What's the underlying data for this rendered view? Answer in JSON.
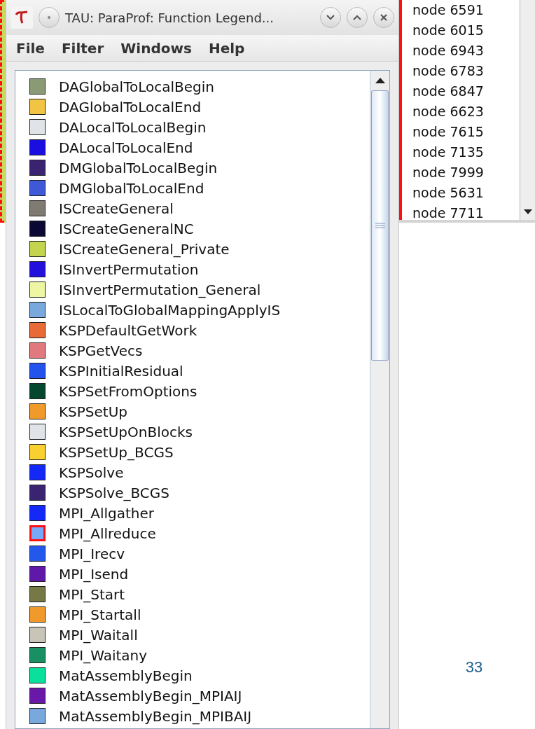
{
  "window": {
    "title": "TAU: ParaProf: Function Legend..."
  },
  "menu": [
    "File",
    "Filter",
    "Windows",
    "Help"
  ],
  "functions": [
    {
      "name": "DAGlobalToLocalBegin",
      "color": "#8a9a74",
      "selected": false
    },
    {
      "name": "DAGlobalToLocalEnd",
      "color": "#f2c444",
      "selected": false
    },
    {
      "name": "DALocalToLocalBegin",
      "color": "#e0e4e8",
      "selected": false
    },
    {
      "name": "DALocalToLocalEnd",
      "color": "#1a0ee0",
      "selected": false
    },
    {
      "name": "DMGlobalToLocalBegin",
      "color": "#3a2370",
      "selected": false
    },
    {
      "name": "DMGlobalToLocalEnd",
      "color": "#3e58d6",
      "selected": false
    },
    {
      "name": "ISCreateGeneral",
      "color": "#7f7a72",
      "selected": false
    },
    {
      "name": "ISCreateGeneralNC",
      "color": "#0c0834",
      "selected": false
    },
    {
      "name": "ISCreateGeneral_Private",
      "color": "#c4d44e",
      "selected": false
    },
    {
      "name": "ISInvertPermutation",
      "color": "#2410dc",
      "selected": false
    },
    {
      "name": "ISInvertPermutation_General",
      "color": "#eef6a4",
      "selected": false
    },
    {
      "name": "ISLocalToGlobalMappingApplyIS",
      "color": "#78a8dc",
      "selected": false
    },
    {
      "name": "KSPDefaultGetWork",
      "color": "#e86a38",
      "selected": false
    },
    {
      "name": "KSPGetVecs",
      "color": "#e07a7e",
      "selected": false
    },
    {
      "name": "KSPInitialResidual",
      "color": "#2452ec",
      "selected": false
    },
    {
      "name": "KSPSetFromOptions",
      "color": "#05462e",
      "selected": false
    },
    {
      "name": "KSPSetUp",
      "color": "#f09a2c",
      "selected": false
    },
    {
      "name": "KSPSetUpOnBlocks",
      "color": "#e0e4e8",
      "selected": false
    },
    {
      "name": "KSPSetUp_BCGS",
      "color": "#f8d030",
      "selected": false
    },
    {
      "name": "KSPSolve",
      "color": "#1428f8",
      "selected": false
    },
    {
      "name": "KSPSolve_BCGS",
      "color": "#3a2370",
      "selected": false
    },
    {
      "name": "MPI_Allgather",
      "color": "#1428f8",
      "selected": false
    },
    {
      "name": "MPI_Allreduce",
      "color": "#78a8f8",
      "selected": true
    },
    {
      "name": "MPI_Irecv",
      "color": "#2458ec",
      "selected": false
    },
    {
      "name": "MPI_Isend",
      "color": "#6018a8",
      "selected": false
    },
    {
      "name": "MPI_Start",
      "color": "#767846",
      "selected": false
    },
    {
      "name": "MPI_Startall",
      "color": "#f09a2c",
      "selected": false
    },
    {
      "name": "MPI_Waitall",
      "color": "#c8c4b8",
      "selected": false
    },
    {
      "name": "MPI_Waitany",
      "color": "#189064",
      "selected": false
    },
    {
      "name": "MatAssemblyBegin",
      "color": "#08e09c",
      "selected": false
    },
    {
      "name": "MatAssemblyBegin_MPIAIJ",
      "color": "#6a18a8",
      "selected": false
    },
    {
      "name": "MatAssemblyBegin_MPIBAIJ",
      "color": "#78a8dc",
      "selected": false
    }
  ],
  "node_list": [
    "node 6591",
    "node 6015",
    "node 6943",
    "node 6783",
    "node 6847",
    "node 6623",
    "node 7615",
    "node 7135",
    "node 7999",
    "node 5631",
    "node 7711"
  ],
  "page_number": "33"
}
